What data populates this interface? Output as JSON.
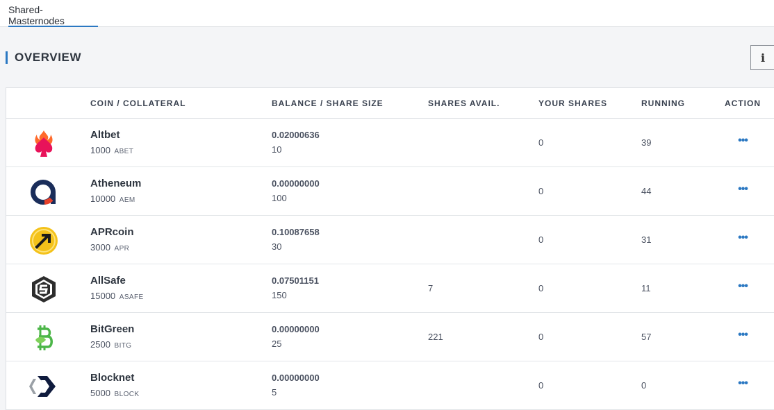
{
  "tabs": [
    {
      "label": "Shared-Masternodes"
    }
  ],
  "section": {
    "title": "OVERVIEW"
  },
  "info_button": {
    "glyph": "i"
  },
  "table": {
    "headers": {
      "coin": "COIN / COLLATERAL",
      "balance": "BALANCE / SHARE SIZE",
      "shares_avail": "SHARES AVAIL.",
      "your_shares": "YOUR SHARES",
      "running": "RUNNING",
      "action": "ACTION"
    },
    "rows": [
      {
        "name": "Altbet",
        "collateral": "1000",
        "ticker": "ABET",
        "balance": "0.02000636",
        "share_size": "10",
        "shares_avail": "",
        "your_shares": "0",
        "running": "39",
        "action": "•••",
        "icon": "altbet-logo-icon"
      },
      {
        "name": "Atheneum",
        "collateral": "10000",
        "ticker": "AEM",
        "balance": "0.00000000",
        "share_size": "100",
        "shares_avail": "",
        "your_shares": "0",
        "running": "44",
        "action": "•••",
        "icon": "atheneum-logo-icon"
      },
      {
        "name": "APRcoin",
        "collateral": "3000",
        "ticker": "APR",
        "balance": "0.10087658",
        "share_size": "30",
        "shares_avail": "",
        "your_shares": "0",
        "running": "31",
        "action": "•••",
        "icon": "aprcoin-logo-icon"
      },
      {
        "name": "AllSafe",
        "collateral": "15000",
        "ticker": "ASAFE",
        "balance": "0.07501151",
        "share_size": "150",
        "shares_avail": "7",
        "your_shares": "0",
        "running": "11",
        "action": "•••",
        "icon": "allsafe-logo-icon"
      },
      {
        "name": "BitGreen",
        "collateral": "2500",
        "ticker": "BITG",
        "balance": "0.00000000",
        "share_size": "25",
        "shares_avail": "221",
        "your_shares": "0",
        "running": "57",
        "action": "•••",
        "icon": "bitgreen-logo-icon"
      },
      {
        "name": "Blocknet",
        "collateral": "5000",
        "ticker": "BLOCK",
        "balance": "0.00000000",
        "share_size": "5",
        "shares_avail": "",
        "your_shares": "0",
        "running": "0",
        "action": "•••",
        "icon": "blocknet-logo-icon"
      }
    ]
  },
  "colors": {
    "accent": "#2b78c2",
    "background": "#f4f5f7",
    "text": "#3a4250"
  }
}
